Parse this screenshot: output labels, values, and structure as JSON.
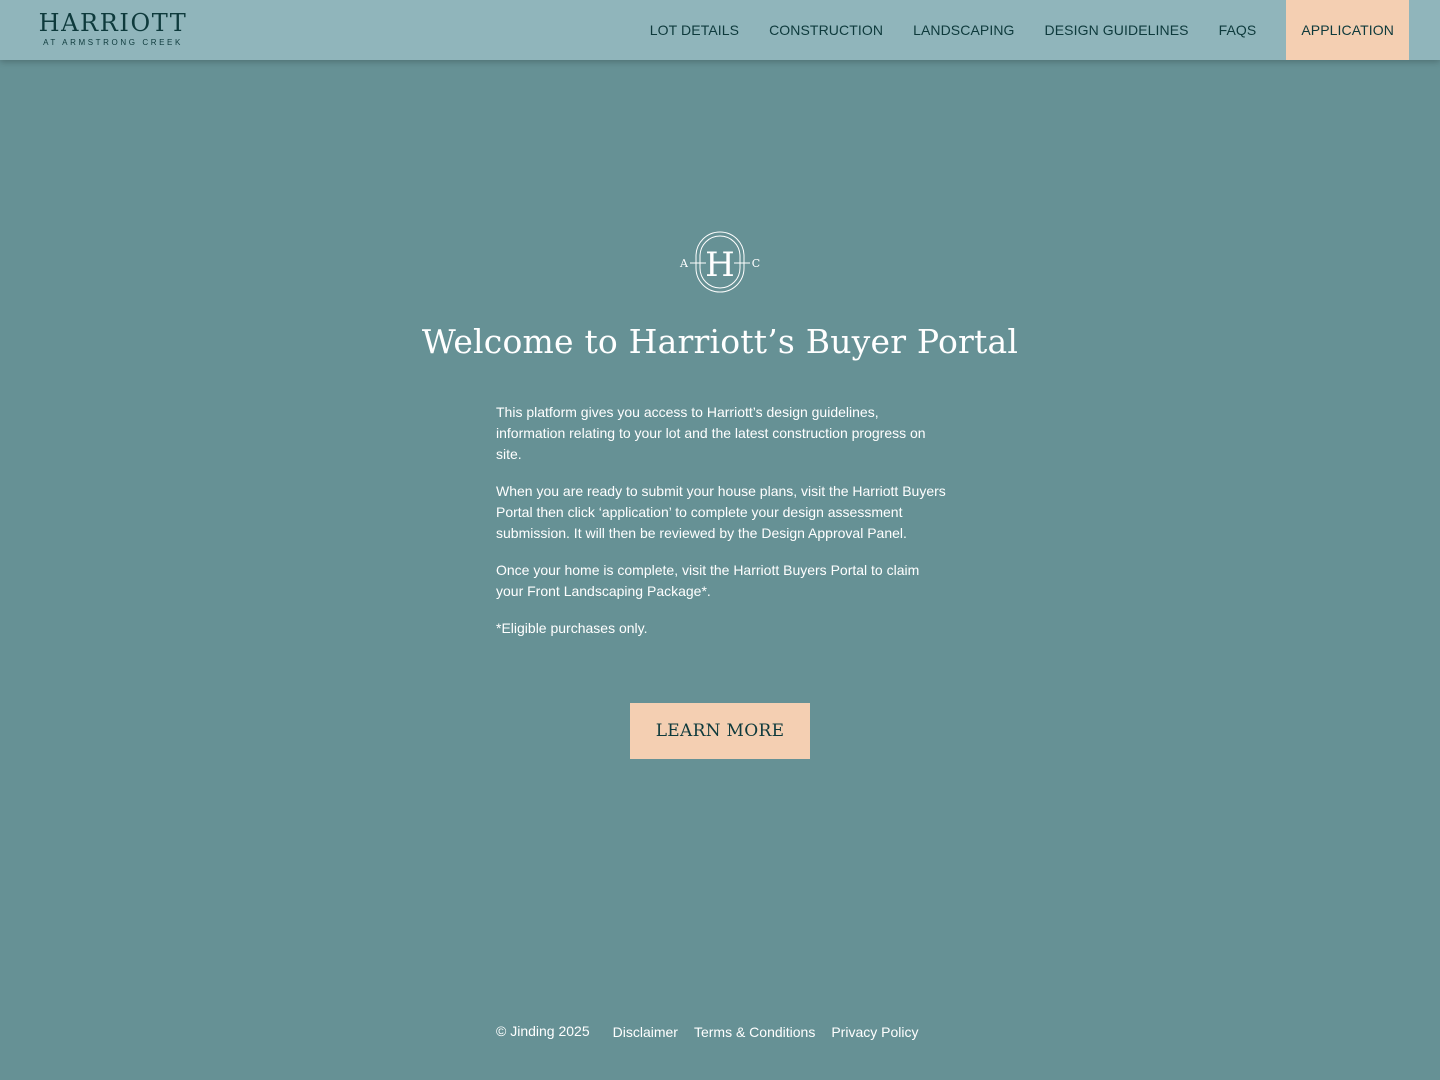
{
  "header": {
    "logo_title": "HARRIOTT",
    "logo_subtitle": "AT ARMSTRONG CREEK",
    "nav": [
      {
        "label": "LOT DETAILS"
      },
      {
        "label": "CONSTRUCTION"
      },
      {
        "label": "LANDSCAPING"
      },
      {
        "label": "DESIGN GUIDELINES"
      },
      {
        "label": "FAQS"
      },
      {
        "label": "APPLICATION"
      }
    ]
  },
  "main": {
    "monogram": {
      "left": "A",
      "center": "H",
      "right": "C"
    },
    "title": "Welcome to Harriott’s Buyer Portal",
    "paragraphs": [
      "This platform gives you access to Harriott’s design guidelines, information relating to your lot and the latest construction progress on site.",
      "When you are ready to submit your house plans, visit the Harriott Buyers Portal then click ‘application’ to complete your design assessment submission. It will then be reviewed by the Design Approval Panel.",
      "Once your home is complete, visit the Harriott Buyers Portal to claim your Front Landscaping Package*.",
      "*Eligible purchases only."
    ],
    "cta_label": "LEARN MORE"
  },
  "footer": {
    "copyright": "© Jinding 2025",
    "links": [
      {
        "label": "Disclaimer"
      },
      {
        "label": "Terms & Conditions"
      },
      {
        "label": "Privacy Policy"
      }
    ]
  },
  "colors": {
    "background": "#669195",
    "header_background": "#90b5bb",
    "accent": "#f4cfb2",
    "dark_text": "#0e3a3c",
    "light_text": "#ffffff"
  }
}
